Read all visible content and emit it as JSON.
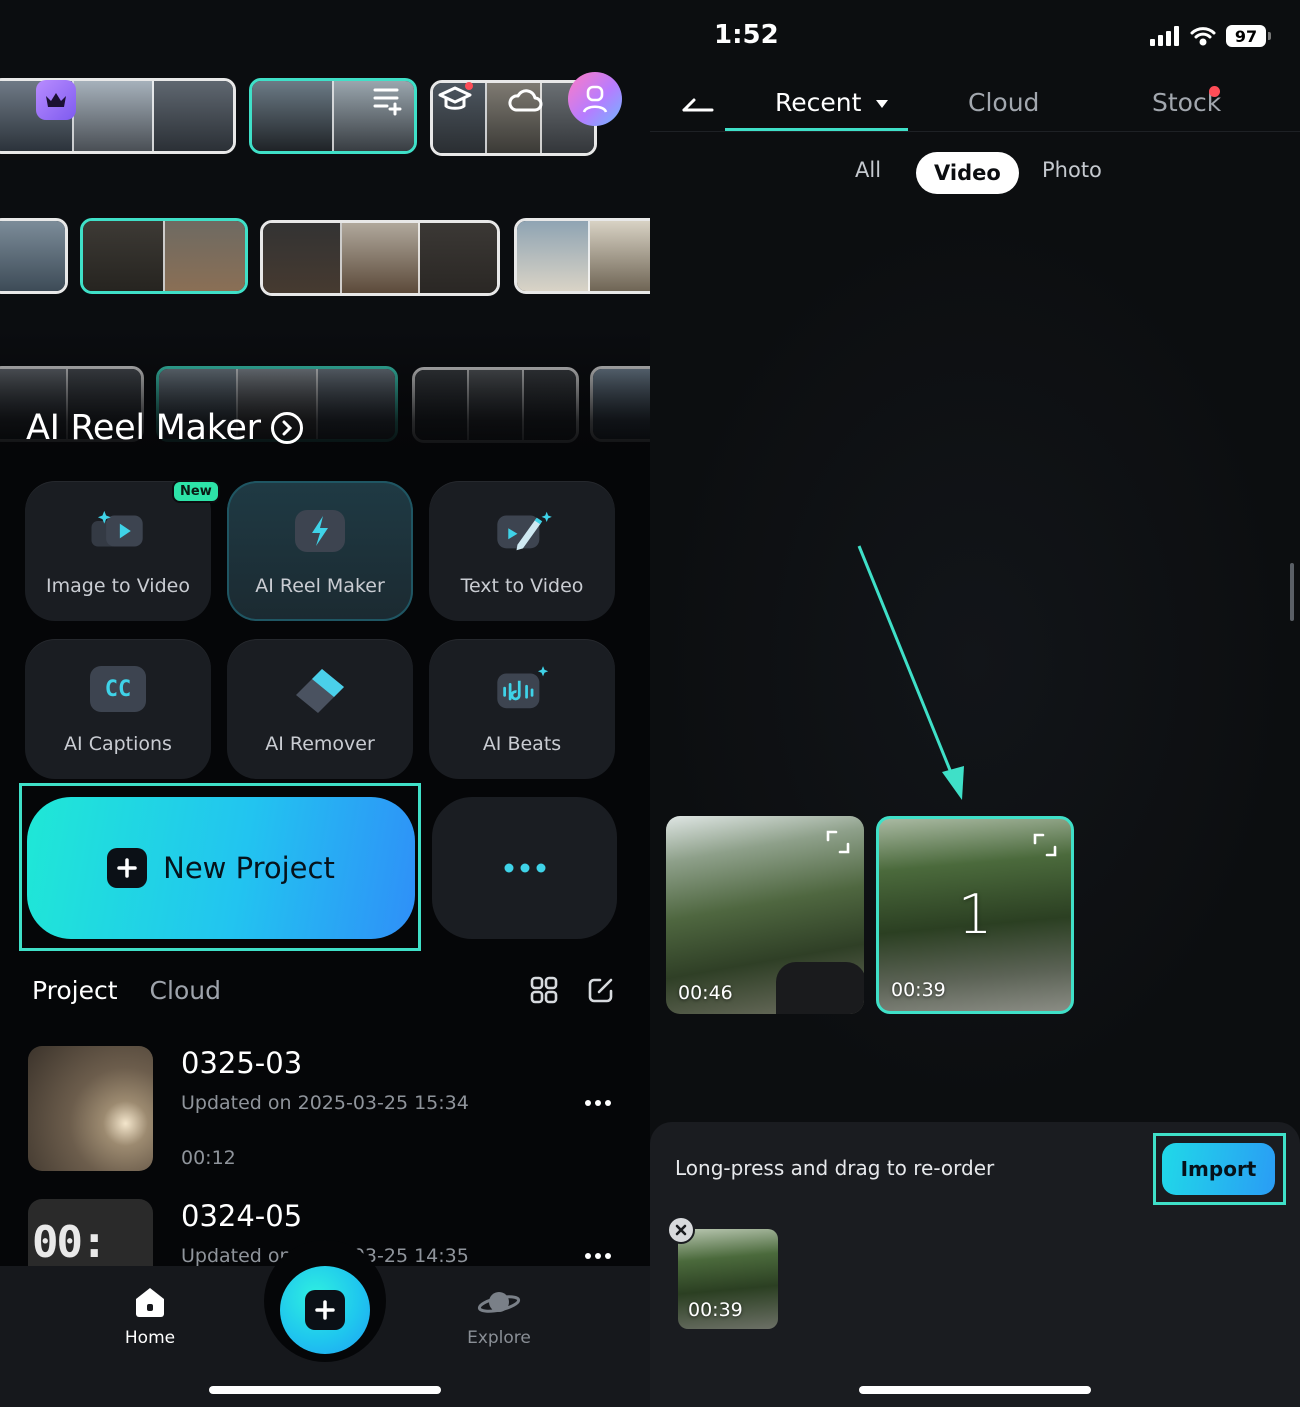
{
  "left": {
    "hero": {
      "title": "AI Reel Maker"
    },
    "tools": [
      {
        "label": "Image to Video",
        "badge": "New"
      },
      {
        "label": "AI Reel Maker"
      },
      {
        "label": "Text to Video"
      },
      {
        "label": "AI Captions",
        "icon_text": "CC"
      },
      {
        "label": "AI Remover"
      },
      {
        "label": "AI Beats"
      }
    ],
    "new_project": {
      "label": "New Project"
    },
    "project_tabs": {
      "active": "Project",
      "inactive": "Cloud"
    },
    "projects": [
      {
        "name": "0325-03",
        "updated": "Updated on 2025-03-25 15:34",
        "duration": "00:12"
      },
      {
        "name": "0324-05",
        "updated": "Updated on 2025-03-25 14:35",
        "thumb_text": "00:"
      }
    ],
    "nav": {
      "home": "Home",
      "explore": "Explore"
    }
  },
  "right": {
    "status": {
      "time": "1:52",
      "battery": "97"
    },
    "tabs": [
      {
        "label": "Recent",
        "active": true
      },
      {
        "label": "Cloud"
      },
      {
        "label": "Stock",
        "dot": true
      }
    ],
    "filters": [
      "All",
      "Video",
      "Photo"
    ],
    "active_filter": "Video",
    "videos": [
      {
        "duration": "00:46"
      },
      {
        "duration": "00:39",
        "selected_index": "1"
      }
    ],
    "tray": {
      "hint": "Long-press and drag to re-order",
      "import_label": "Import",
      "selected_duration": "00:39"
    }
  },
  "colors": {
    "accent": "#3fe0c8",
    "button_gradient_start": "#1fe8d6",
    "button_gradient_end": "#2f8ff8",
    "tile_bg": "#1a1d22",
    "notification": "#ff4d57"
  },
  "icons": [
    "crown-icon",
    "playlist-add-icon",
    "graduation-cap-icon",
    "cloud-icon",
    "user-icon",
    "chevron-right-circle-icon",
    "image-video-icon",
    "lightning-icon",
    "pencil-video-icon",
    "cc-icon",
    "eraser-icon",
    "music-beats-icon",
    "plus-icon",
    "more-dots-icon",
    "grid-icon",
    "edit-icon",
    "home-icon",
    "planet-icon",
    "back-arrow-icon",
    "caret-down-icon",
    "expand-icon",
    "close-icon",
    "signal-icon",
    "wifi-icon"
  ]
}
